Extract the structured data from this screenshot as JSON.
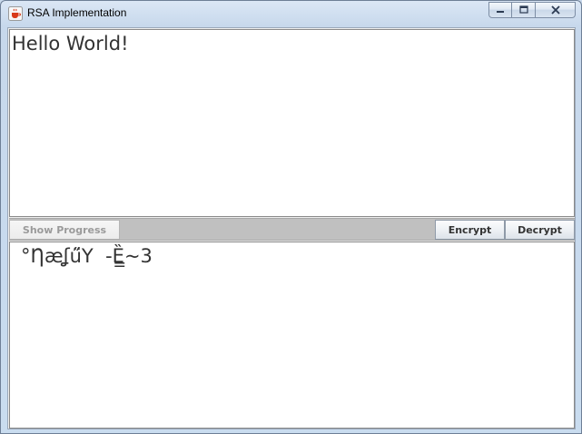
{
  "window": {
    "title": "RSA Implementation"
  },
  "input_area": {
    "text": "Hello World!"
  },
  "toolbar": {
    "show_progress_label": "Show Progress",
    "encrypt_label": "Encrypt",
    "decrypt_label": "Decrypt"
  },
  "output_area": {
    "text": "°Ƞæʆű̈Y  -Ȅ̳~3"
  },
  "icons": {
    "app": "java-coffee-cup-icon",
    "minimize": "minimize-icon",
    "maximize": "maximize-icon",
    "close": "close-icon"
  },
  "colors": {
    "titlebar": "#c7d8ec",
    "toolbar_strip": "#c0c0c0",
    "text_area_bg": "#ffffff",
    "text_color": "#333333"
  }
}
